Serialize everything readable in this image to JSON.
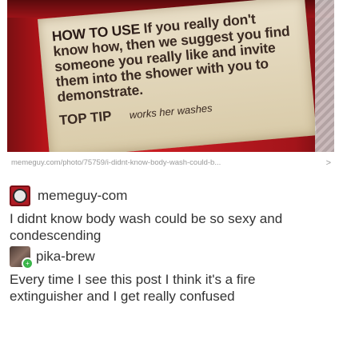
{
  "photo": {
    "label_lines": {
      "heading": "HOW TO USE",
      "body": "If you really don't know how, then we suggest you find someone you really like and invite them into the shower with you to demonstrate.",
      "tip": "TOP TIP",
      "tip_tail": "works her washes"
    },
    "bottle_color": "#c81d23"
  },
  "source": {
    "url": "memeguy.com/photo/75759/i-didnt-know-body-wash-could-b...",
    "chevron": ">"
  },
  "posts": [
    {
      "username": "memeguy-com",
      "avatar_icon": "memeguy-logo-icon",
      "text": "I didnt know body wash could be so sexy and condescending"
    },
    {
      "username": "pika-brew",
      "avatar_icon": "pika-brew-avatar-icon",
      "text": "Every time I see this post I think it's a fire extinguisher and I get really confused"
    }
  ]
}
